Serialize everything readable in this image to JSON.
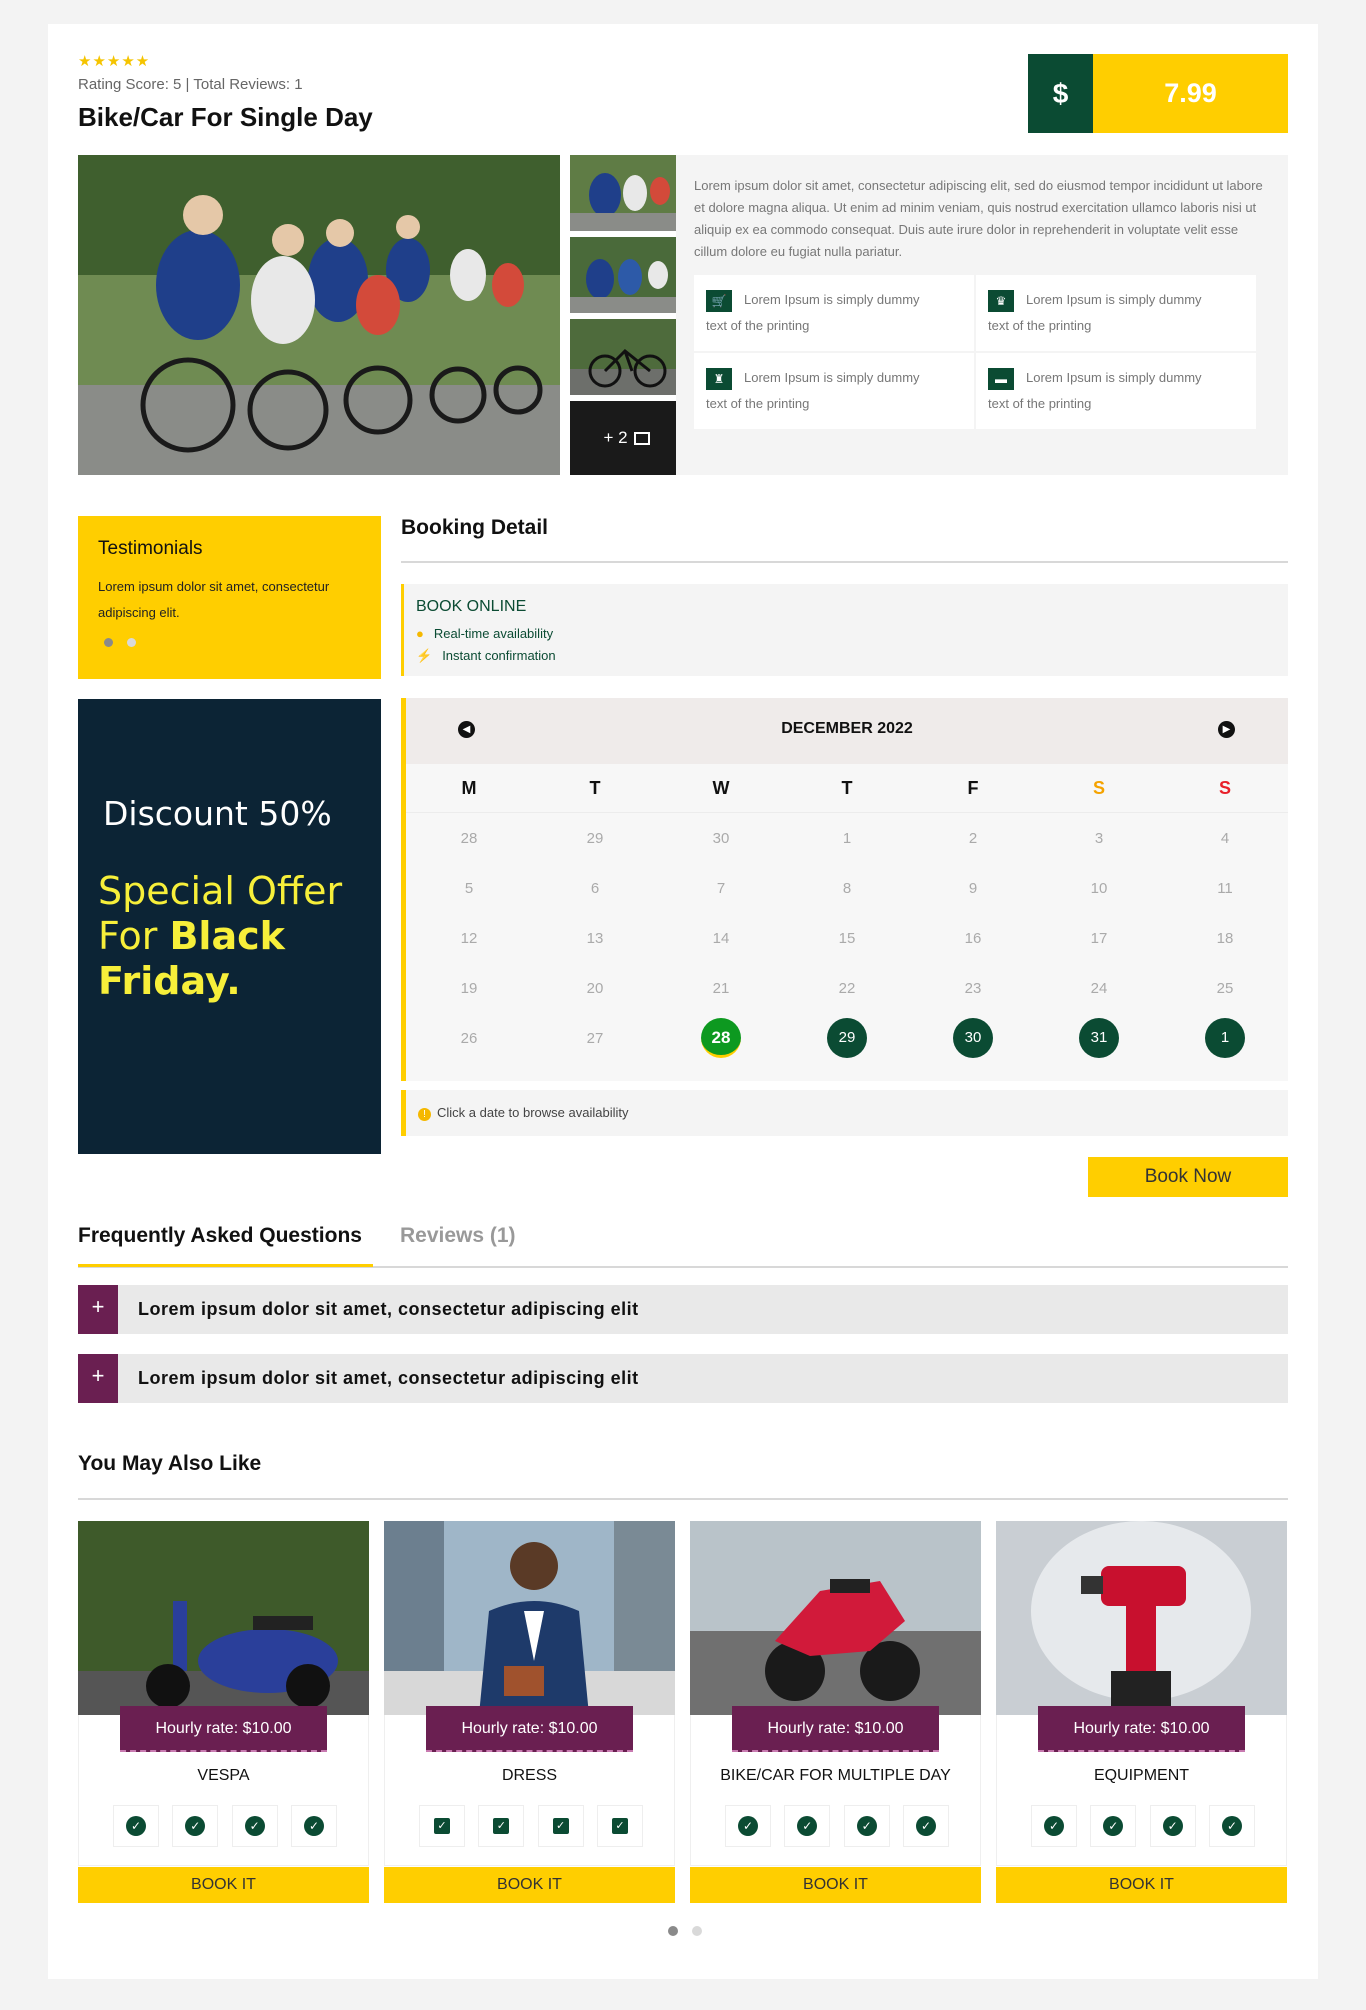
{
  "product": {
    "stars": "★★★★★",
    "rating_text": "Rating Score: 5 | Total Reviews: 1",
    "title": "Bike/Car For Single Day",
    "currency_symbol": "$",
    "price": "7.99"
  },
  "gallery": {
    "more_label": "+ 2",
    "more_icon": "image-icon"
  },
  "info": {
    "description": "Lorem ipsum dolor sit amet, consectetur adipiscing elit, sed do eiusmod tempor incididunt ut labore et dolore magna aliqua. Ut enim ad minim veniam, quis nostrud exercitation ullamco laboris nisi ut aliquip ex ea commodo consequat. Duis aute irure dolor in reprehenderit in voluptate velit esse cillum dolore eu fugiat nulla pariatur.",
    "features": [
      {
        "icon": "cart-icon",
        "line1": "Lorem Ipsum is simply dummy",
        "line2": "text of the printing"
      },
      {
        "icon": "crown-icon",
        "line1": "Lorem Ipsum is simply dummy",
        "line2": "text of the printing"
      },
      {
        "icon": "tower-icon",
        "line1": "Lorem Ipsum is simply dummy",
        "line2": "text of the printing"
      },
      {
        "icon": "sofa-icon",
        "line1": "Lorem Ipsum is simply dummy",
        "line2": "text of the printing"
      }
    ]
  },
  "testimonials": {
    "title": "Testimonials",
    "text": "Lorem ipsum dolor sit amet, consectetur adipiscing elit."
  },
  "promo": {
    "discount": "Discount 50%",
    "line1": "Special Offer",
    "line2_prefix": "For ",
    "line2_bold": "Black",
    "line3_bold": "Friday."
  },
  "booking": {
    "title": "Booking Detail",
    "book_online": "BOOK ONLINE",
    "realtime": "Real-time availability",
    "instant": "Instant confirmation",
    "month": "DECEMBER 2022",
    "weekdays": [
      "M",
      "T",
      "W",
      "T",
      "F",
      "S",
      "S"
    ],
    "hint": "Click a date to browse availability",
    "book_now": "Book Now"
  },
  "calendar_weeks": [
    [
      "28",
      "29",
      "30",
      "1",
      "2",
      "3",
      "4"
    ],
    [
      "5",
      "6",
      "7",
      "8",
      "9",
      "10",
      "11"
    ],
    [
      "12",
      "13",
      "14",
      "15",
      "16",
      "17",
      "18"
    ],
    [
      "19",
      "20",
      "21",
      "22",
      "23",
      "24",
      "25"
    ],
    [
      "26",
      "27",
      "28",
      "29",
      "30",
      "31",
      "1"
    ]
  ],
  "tabs": {
    "faq": "Frequently Asked Questions",
    "reviews": "Reviews (1)"
  },
  "faq": [
    {
      "question": "Lorem ipsum dolor sit amet, consectetur adipiscing elit"
    },
    {
      "question": "Lorem ipsum dolor sit amet, consectetur adipiscing elit"
    }
  ],
  "also": {
    "title": "You May Also Like",
    "cards": [
      {
        "rate": "Hourly rate: $10.00",
        "name": "VESPA",
        "book": "BOOK IT"
      },
      {
        "rate": "Hourly rate: $10.00",
        "name": "DRESS",
        "book": "BOOK IT"
      },
      {
        "rate": "Hourly rate: $10.00",
        "name": "BIKE/CAR FOR MULTIPLE DAY",
        "book": "BOOK IT"
      },
      {
        "rate": "Hourly rate: $10.00",
        "name": "EQUIPMENT",
        "book": "BOOK IT"
      }
    ]
  },
  "colors": {
    "accent_yellow": "#ffce00",
    "dark_green": "#0b4b33",
    "plum": "#6a1f51",
    "navy": "#0c2435",
    "today_green": "#0d9920"
  }
}
